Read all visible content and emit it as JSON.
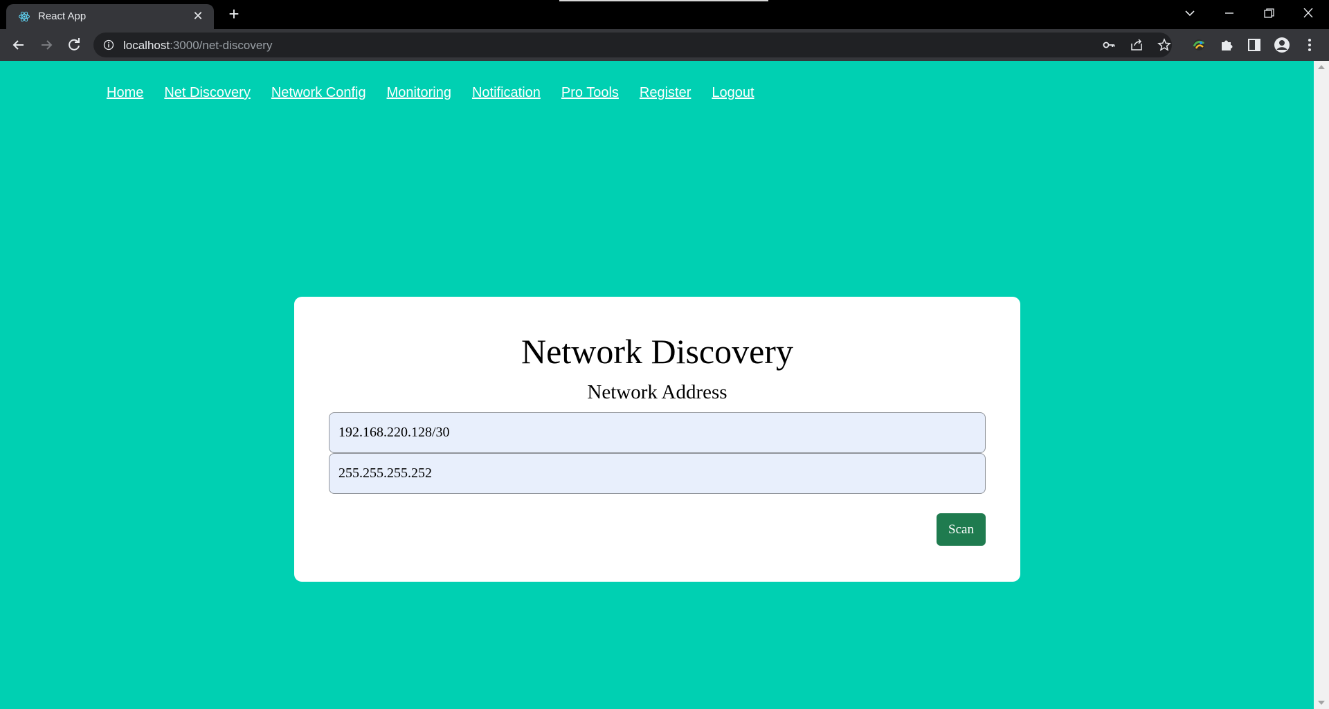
{
  "browser": {
    "tab_title": "React App",
    "url_host": "localhost",
    "url_path": ":3000/net-discovery"
  },
  "nav": {
    "items": [
      "Home",
      "Net Discovery",
      "Network Config",
      "Monitoring",
      "Notification",
      "Pro Tools",
      "Register",
      "Logout"
    ]
  },
  "card": {
    "title": "Network Discovery",
    "subtitle": "Network Address",
    "address_value": "192.168.220.128/30",
    "mask_value": "255.255.255.252",
    "scan_label": "Scan"
  },
  "colors": {
    "page_bg": "#00d0b2",
    "scan_button": "#1f7b4f",
    "input_bg": "#e8effc"
  }
}
